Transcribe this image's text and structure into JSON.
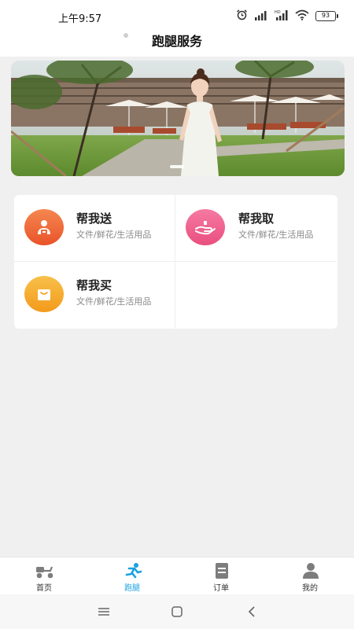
{
  "status_bar": {
    "time": "上午9:57",
    "battery": "93",
    "icons": [
      "alarm-icon",
      "signal-icon",
      "signal-hd-icon",
      "wifi-icon",
      "battery-icon"
    ]
  },
  "header": {
    "title": "跑腿服务"
  },
  "banner": {
    "image": "banner-photo",
    "page_indicator_active": 1
  },
  "services": [
    {
      "title": "帮我送",
      "subtitle": "文件/鲜花/生活用品",
      "icon": "send-package-icon",
      "color": "#f0683a"
    },
    {
      "title": "帮我取",
      "subtitle": "文件/鲜花/生活用品",
      "icon": "hand-pickup-icon",
      "color": "#f0618e"
    },
    {
      "title": "帮我买",
      "subtitle": "文件/鲜花/生活用品",
      "icon": "shopping-bag-icon",
      "color": "#f6a82a"
    }
  ],
  "tabs": [
    {
      "label": "首页",
      "icon": "scooter-icon",
      "active": false
    },
    {
      "label": "跑腿",
      "icon": "runner-icon",
      "active": true
    },
    {
      "label": "订单",
      "icon": "order-list-icon",
      "active": false
    },
    {
      "label": "我的",
      "icon": "profile-icon",
      "active": false
    }
  ],
  "colors": {
    "accent": "#1aa1e0",
    "background": "#f0f0f0"
  }
}
